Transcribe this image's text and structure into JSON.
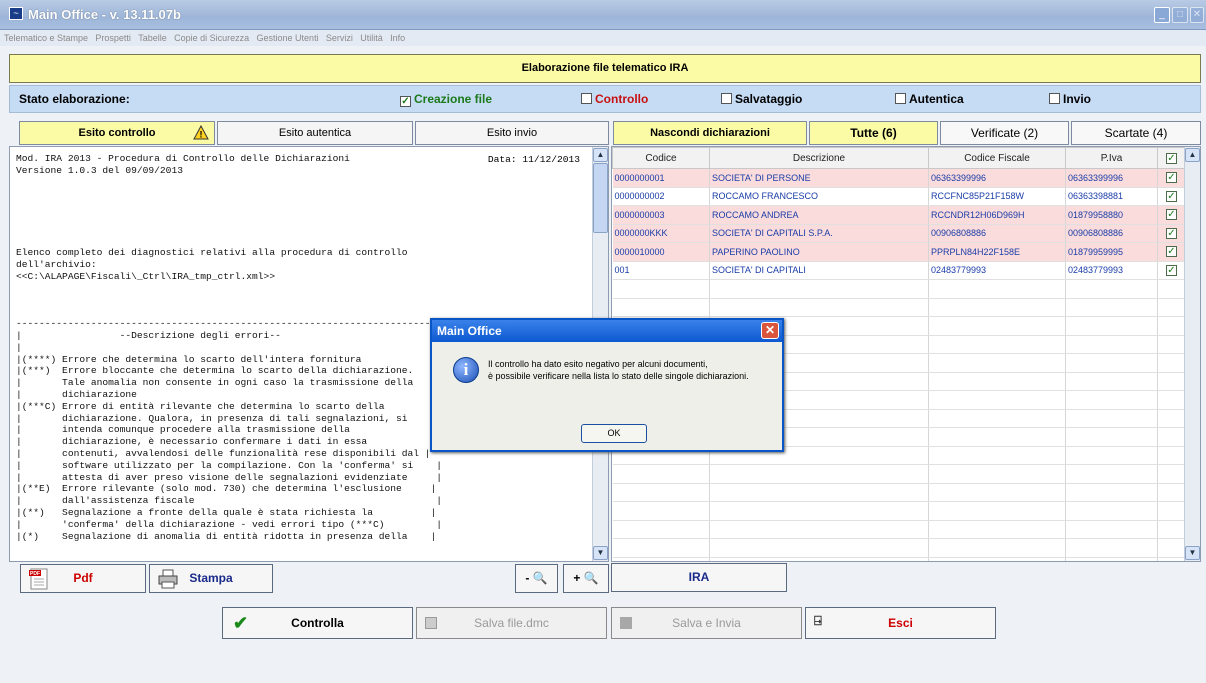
{
  "window": {
    "title": "Main Office - v. 13.11.07b"
  },
  "menu": [
    "Telematico e Stampe",
    "Prospetti",
    "Tabelle",
    "Copie di Sicurezza",
    "Gestione Utenti",
    "Servizi",
    "Utilità",
    "Info"
  ],
  "header": {
    "title": "Elaborazione file telematico IRA"
  },
  "status": {
    "label": "Stato elaborazione:",
    "steps": [
      {
        "label": "Creazione file",
        "checked": true,
        "color": "#1b7a1b"
      },
      {
        "label": "Controllo",
        "checked": false,
        "color": "#c81010"
      },
      {
        "label": "Salvataggio",
        "checked": false,
        "color": "#000000"
      },
      {
        "label": "Autentica",
        "checked": false,
        "color": "#000000"
      },
      {
        "label": "Invio",
        "checked": false,
        "color": "#000000"
      }
    ]
  },
  "left_tabs": {
    "esito_controllo": "Esito controllo",
    "esito_autentica": "Esito autentica",
    "esito_invio": "Esito invio"
  },
  "right_tabs": {
    "nascondi": "Nascondi dichiarazioni",
    "tutte": "Tutte (6)",
    "verificate": "Verificate (2)",
    "scartate": "Scartate (4)"
  },
  "report": {
    "date": "Data: 11/12/2013",
    "text": "Mod. IRA 2013 - Procedura di Controllo delle Dichiarazioni\nVersione 1.0.3 del 09/09/2013\n\n\n\n\n\n\nElenco completo dei diagnostici relativi alla procedura di controllo\ndell'archivio:\n<<C:\\ALAPAGE\\Fiscali\\_Ctrl\\IRA_tmp_ctrl.xml>>\n\n\n\n--------------------------------------------------------------------------\n|                 --Descrizione degli errori--                           |\n|                                                                        |\n|(****) Errore che determina lo scarto dell'intera fornitura            |\n|(***)  Errore bloccante che determina lo scarto della dichiarazione.   |\n|       Tale anomalia non consente in ogni caso la trasmissione della   |\n|       dichiarazione                                                    |\n|(***C) Errore di entità rilevante che determina lo scarto della        |\n|       dichiarazione. Qualora, in presenza di tali segnalazioni, si     |\n|       intenda comunque procedere alla trasmissione della               |\n|       dichiarazione, è necessario confermare i dati in essa           |\n|       contenuti, avvalendosi delle funzionalità rese disponibili dal |\n|       software utilizzato per la compilazione. Con la 'conferma' si    |\n|       attesta di aver preso visione delle segnalazioni evidenziate     |\n|(**E)  Errore rilevante (solo mod. 730) che determina l'esclusione     |\n|       dall'assistenza fiscale                                          |\n|(**)   Segnalazione a fronte della quale è stata richiesta la          |\n|       'conferma' della dichiarazione - vedi errori tipo (***C)         |\n|(*)    Segnalazione di anomalia di entità ridotta in presenza della    |"
  },
  "grid": {
    "columns": [
      "Codice",
      "Descrizione",
      "Codice Fiscale",
      "P.Iva"
    ],
    "rows": [
      {
        "codice": "0000000001",
        "descrizione": "SOCIETA' DI PERSONE",
        "cf": "06363399996",
        "piva": "06363399996",
        "checked": true,
        "highlight": true
      },
      {
        "codice": "0000000002",
        "descrizione": "ROCCAMO FRANCESCO",
        "cf": "RCCFNC85P21F158W",
        "piva": "06363398881",
        "checked": true,
        "highlight": false
      },
      {
        "codice": "0000000003",
        "descrizione": "ROCCAMO ANDREA",
        "cf": "RCCNDR12H06D969H",
        "piva": "01879958880",
        "checked": true,
        "highlight": true
      },
      {
        "codice": "0000000KKK",
        "descrizione": "SOCIETA' DI CAPITALI S.P.A.",
        "cf": "00906808886",
        "piva": "00906808886",
        "checked": true,
        "highlight": true
      },
      {
        "codice": "0000010000",
        "descrizione": "PAPERINO PAOLINO",
        "cf": "PPRPLN84H22F158E",
        "piva": "01879959995",
        "checked": true,
        "highlight": true
      },
      {
        "codice": "001",
        "descrizione": "SOCIETA' DI CAPITALI",
        "cf": "02483779993",
        "piva": "02483779993",
        "checked": true,
        "highlight": false
      }
    ]
  },
  "toolbar": {
    "pdf": "Pdf",
    "stampa": "Stampa",
    "zoom_out": "- 🔍",
    "zoom_in": "+ 🔍",
    "ira": "IRA"
  },
  "actions": {
    "controlla": "Controlla",
    "salva_dmc": "Salva file.dmc",
    "salva_invia": "Salva e Invia",
    "esci": "Esci"
  },
  "dialog": {
    "title": "Main Office",
    "message_line1": "Il controllo ha dato esito negativo per alcuni documenti,",
    "message_line2": "è possibile verificare nella lista lo stato delle singole dichiarazioni.",
    "ok": "OK"
  }
}
